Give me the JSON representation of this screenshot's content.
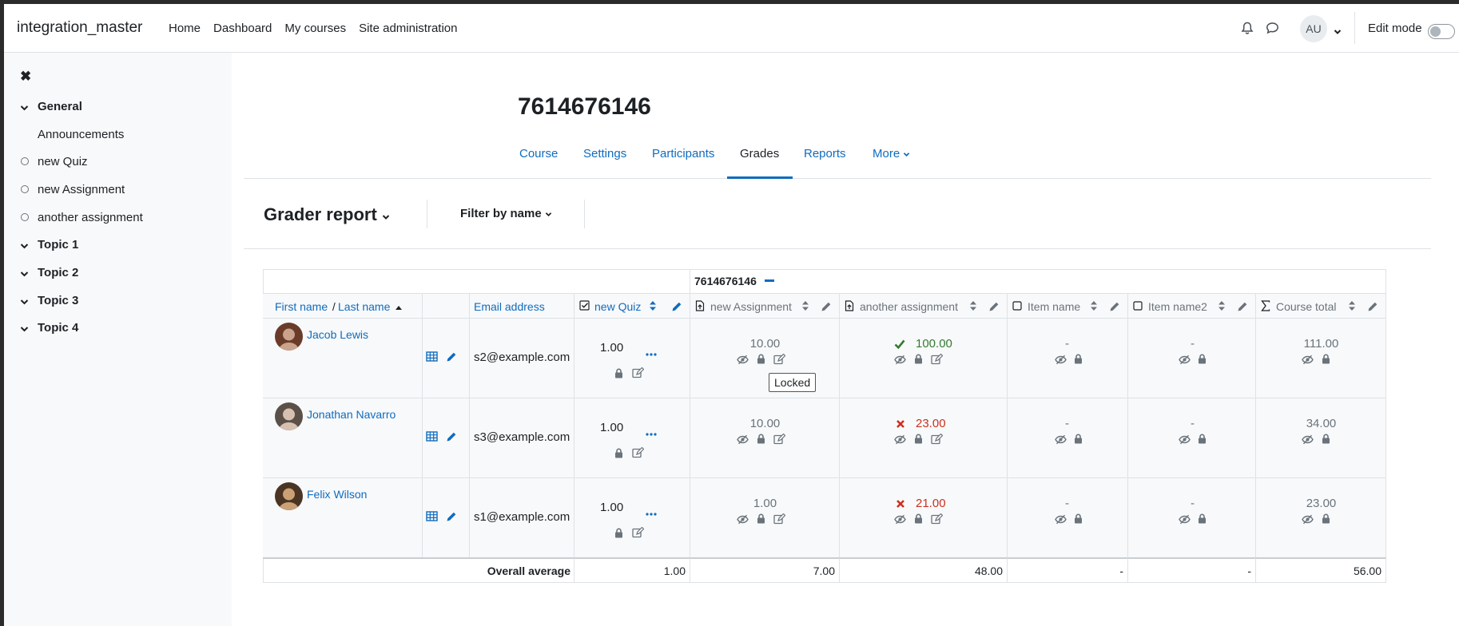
{
  "navbar": {
    "site_name": "integration_master",
    "links": [
      "Home",
      "Dashboard",
      "My courses",
      "Site administration"
    ],
    "avatar_initials": "AU",
    "edit_mode_label": "Edit mode",
    "edit_mode_on": false
  },
  "drawer": {
    "items": [
      {
        "label": "General",
        "type": "section"
      },
      {
        "label": "Announcements",
        "type": "forum"
      },
      {
        "label": "new Quiz",
        "type": "activity"
      },
      {
        "label": "new Assignment",
        "type": "activity"
      },
      {
        "label": "another assignment",
        "type": "activity"
      },
      {
        "label": "Topic 1",
        "type": "section"
      },
      {
        "label": "Topic 2",
        "type": "section"
      },
      {
        "label": "Topic 3",
        "type": "section"
      },
      {
        "label": "Topic 4",
        "type": "section"
      }
    ]
  },
  "course": {
    "title": "7614676146",
    "tabs": [
      "Course",
      "Settings",
      "Participants",
      "Grades",
      "Reports",
      "More"
    ],
    "active_tab": "Grades"
  },
  "toolbar": {
    "report_title": "Grader report",
    "filter_label": "Filter by name"
  },
  "grader": {
    "category_header": "7614676146",
    "first_name": "First name",
    "name_separator": " / ",
    "last_name": "Last name",
    "email_header": "Email address",
    "items": [
      "new Quiz",
      "new Assignment",
      "another assignment",
      "Item name",
      "Item name2",
      "Course total"
    ],
    "rows": [
      {
        "name": "Jacob Lewis",
        "email": "s2@example.com",
        "quiz": "1.00",
        "assignment": "10.00",
        "another": "100.00",
        "another_status": "pass",
        "item1": "-",
        "item2": "-",
        "total": "111.00"
      },
      {
        "name": "Jonathan Navarro",
        "email": "s3@example.com",
        "quiz": "1.00",
        "assignment": "10.00",
        "another": "23.00",
        "another_status": "fail",
        "item1": "-",
        "item2": "-",
        "total": "34.00"
      },
      {
        "name": "Felix Wilson",
        "email": "s1@example.com",
        "quiz": "1.00",
        "assignment": "1.00",
        "another": "21.00",
        "another_status": "fail",
        "item1": "-",
        "item2": "-",
        "total": "23.00"
      }
    ],
    "overall_label": "Overall average",
    "overall": {
      "quiz": "1.00",
      "assignment": "7.00",
      "another": "48.00",
      "item1": "-",
      "item2": "-",
      "total": "56.00"
    }
  },
  "tooltip": "Locked",
  "colors": {
    "link": "#0f6cbf",
    "pass": "#357a32",
    "fail": "#ca3120",
    "text": "#1d2125",
    "border": "#dee2e6"
  }
}
